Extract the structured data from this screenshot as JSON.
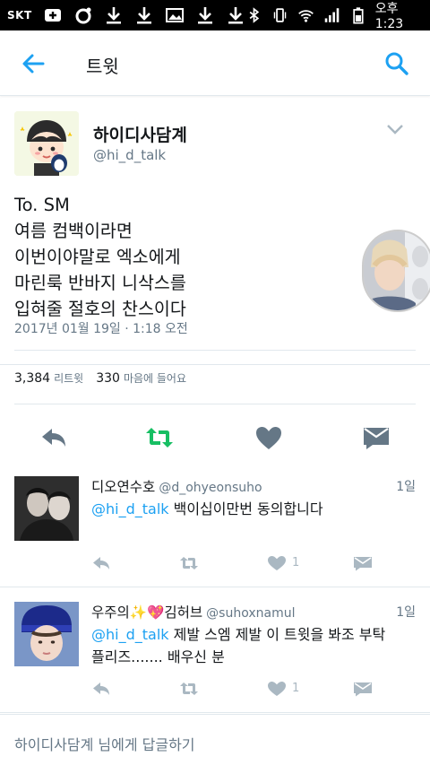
{
  "status_bar": {
    "carrier": "SKT",
    "time": "오후 1:23"
  },
  "app_bar": {
    "title": "트윗"
  },
  "tweet": {
    "author_name": "하이디사담계",
    "author_handle": "@hi_d_talk",
    "text": "To. SM\n여름 컴백이라면\n이번이야말로 엑소에게\n마린룩 반바지 니삭스를\n입혀줄 절호의 찬스이다",
    "timestamp": "2017년 01월 19일 · 1:18 오전",
    "retweet_count": "3,384",
    "retweet_label": "리트윗",
    "like_count": "330",
    "like_label": "마음에 들어요"
  },
  "replies": [
    {
      "name": "디오연수호",
      "handle": "@d_ohyeonsuho",
      "time": "1일",
      "mention": "@hi_d_talk",
      "text": " 백이십이만번 동의합니다",
      "like_count": "1"
    },
    {
      "name": "우주의✨💖김허브",
      "handle": "@suhoxnamul",
      "time": "1일",
      "mention": "@hi_d_talk",
      "text": " 제발 스엠 제발 이 트윗을 봐조 부탁 플리즈....... 배우신 분",
      "like_count": "1"
    }
  ],
  "compose": {
    "placeholder": "하이디사담계 님에게 답글하기"
  },
  "colors": {
    "accent": "#1da1f2",
    "retweet_green": "#17bf63",
    "icon_gray": "#657786",
    "muted_icon": "#aab8c2"
  }
}
